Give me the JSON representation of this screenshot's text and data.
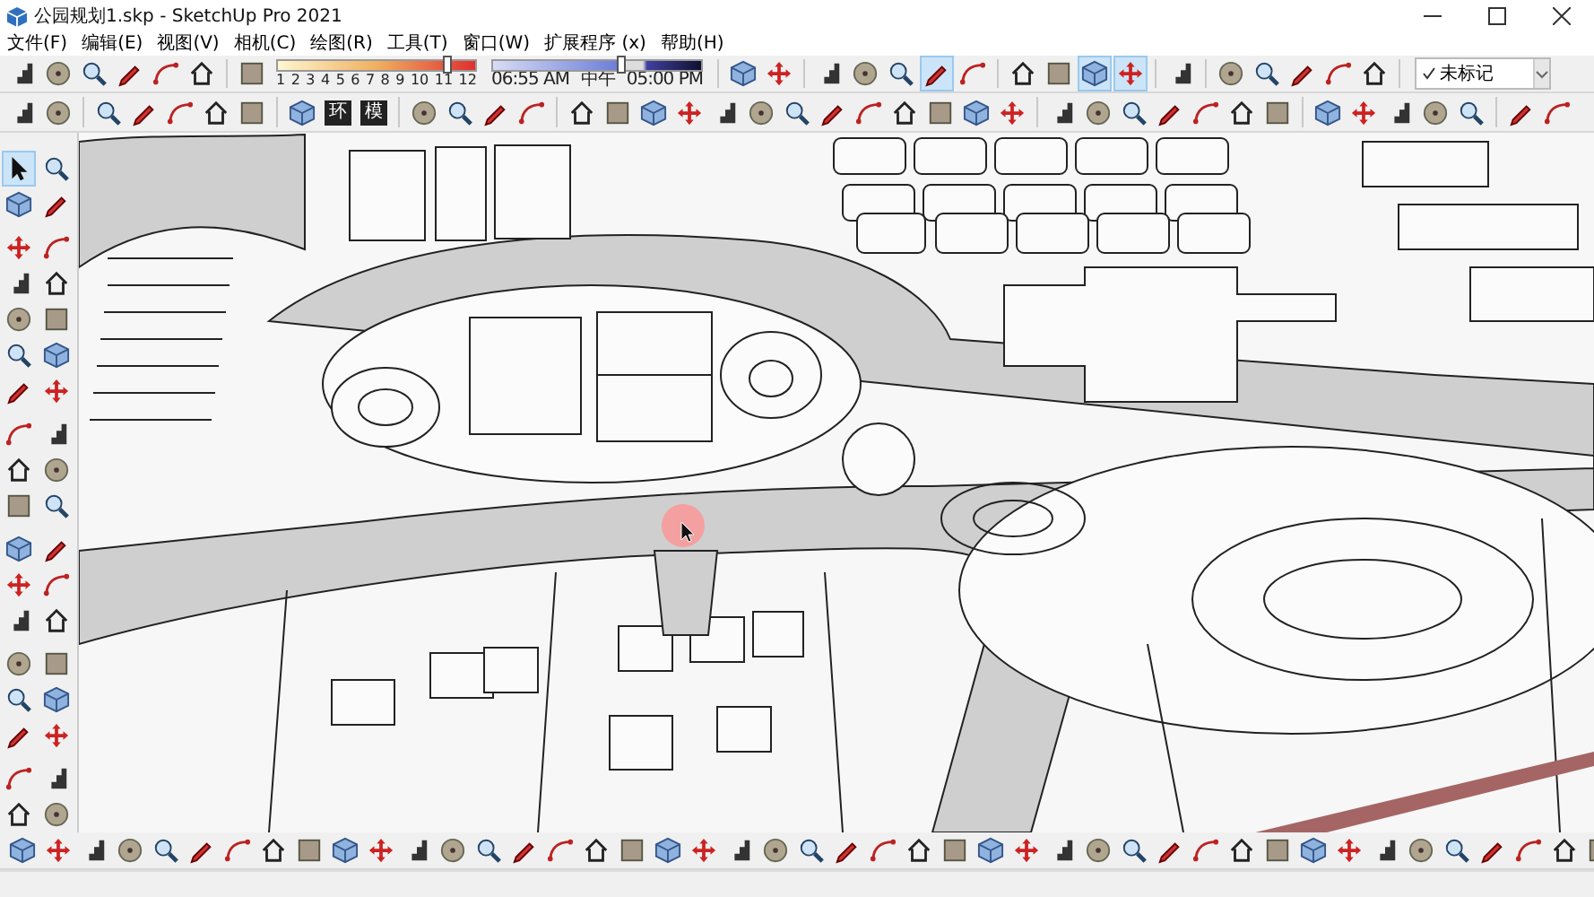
{
  "window": {
    "title": "公园规划1.skp - SketchUp Pro 2021"
  },
  "menu": [
    "文件(F)",
    "编辑(E)",
    "视图(V)",
    "相机(C)",
    "绘图(R)",
    "工具(T)",
    "窗口(W)",
    "扩展程序 (x)",
    "帮助(H)"
  ],
  "toolbar_row_1": [
    {
      "kind": "group",
      "buttons": [
        {
          "selected": false
        },
        {
          "selected": false
        },
        {
          "selected": false
        },
        {
          "selected": false
        },
        {
          "selected": false
        },
        {
          "selected": false
        }
      ]
    },
    {
      "kind": "group",
      "buttons": [
        {
          "selected": false
        }
      ]
    },
    {
      "kind": "month_slider",
      "labels": [
        "1",
        "2",
        "3",
        "4",
        "5",
        "6",
        "7",
        "8",
        "9",
        "10",
        "11",
        "12"
      ],
      "level": 0.86
    },
    {
      "kind": "time_slider",
      "labels": [
        "06:55 AM",
        "中午",
        "05:00 PM"
      ],
      "level": 0.62
    },
    {
      "kind": "group",
      "buttons": [
        {
          "selected": false
        },
        {
          "selected": false
        }
      ]
    },
    {
      "kind": "group",
      "buttons": [
        {
          "selected": false
        },
        {
          "selected": false
        },
        {
          "selected": false
        },
        {
          "selected": true
        },
        {
          "selected": false
        }
      ]
    },
    {
      "kind": "group",
      "buttons": [
        {
          "selected": false
        },
        {
          "selected": false
        },
        {
          "selected": true
        },
        {
          "selected": true
        }
      ]
    },
    {
      "kind": "group",
      "buttons": [
        {
          "selected": false
        }
      ]
    },
    {
      "kind": "group",
      "buttons": [
        {
          "selected": false
        },
        {
          "selected": false
        },
        {
          "selected": false
        },
        {
          "selected": false
        },
        {
          "selected": false
        }
      ]
    },
    {
      "kind": "dropdown",
      "value": "未标记",
      "checked": true
    }
  ],
  "toolbar_row_2": [
    {
      "buttons": [
        {
          "selected": false
        },
        {
          "selected": false
        }
      ]
    },
    {
      "buttons": [
        {
          "selected": false
        },
        {
          "selected": false
        },
        {
          "selected": false
        },
        {
          "selected": false
        },
        {
          "selected": false
        }
      ]
    },
    {
      "buttons": [
        {
          "selected": false
        },
        {
          "selected": false,
          "label": "环"
        },
        {
          "selected": false,
          "label": "模"
        }
      ]
    },
    {
      "buttons": [
        {
          "selected": false
        },
        {
          "selected": false
        },
        {
          "selected": false
        },
        {
          "selected": false
        }
      ]
    },
    {
      "buttons": [
        {
          "selected": false
        },
        {
          "selected": false
        },
        {
          "selected": false
        },
        {
          "selected": false
        },
        {
          "selected": false
        },
        {
          "selected": false
        },
        {
          "selected": false
        },
        {
          "selected": false
        },
        {
          "selected": false
        },
        {
          "selected": false
        },
        {
          "selected": false
        },
        {
          "selected": false
        },
        {
          "selected": false
        }
      ]
    },
    {
      "buttons": [
        {
          "selected": false
        },
        {
          "selected": false
        },
        {
          "selected": false
        },
        {
          "selected": false
        },
        {
          "selected": false
        },
        {
          "selected": false
        },
        {
          "selected": false
        }
      ]
    },
    {
      "buttons": [
        {
          "selected": false
        },
        {
          "selected": false
        },
        {
          "selected": false
        },
        {
          "selected": false
        },
        {
          "selected": false
        }
      ]
    },
    {
      "buttons": [
        {
          "selected": false
        },
        {
          "selected": false
        }
      ]
    }
  ],
  "left_toolbar": [
    {
      "buttons": [
        {
          "selected": true
        },
        {
          "selected": false
        },
        {
          "selected": false
        },
        {
          "selected": false
        }
      ]
    },
    {
      "buttons": [
        {
          "selected": false
        },
        {
          "selected": false
        },
        {
          "selected": false
        },
        {
          "selected": false
        },
        {
          "selected": false
        },
        {
          "selected": false
        },
        {
          "selected": false
        },
        {
          "selected": false
        },
        {
          "selected": false
        },
        {
          "selected": false
        }
      ]
    },
    {
      "buttons": [
        {
          "selected": false
        },
        {
          "selected": false
        },
        {
          "selected": false
        },
        {
          "selected": false
        },
        {
          "selected": false
        },
        {
          "selected": false
        }
      ]
    },
    {
      "buttons": [
        {
          "selected": false
        },
        {
          "selected": false
        },
        {
          "selected": false
        },
        {
          "selected": false
        },
        {
          "selected": false
        },
        {
          "selected": false
        }
      ]
    },
    {
      "buttons": [
        {
          "selected": false
        },
        {
          "selected": false
        },
        {
          "selected": false
        },
        {
          "selected": false
        },
        {
          "selected": false
        },
        {
          "selected": false
        }
      ]
    },
    {
      "buttons": [
        {
          "selected": false
        },
        {
          "selected": false
        },
        {
          "selected": false
        },
        {
          "selected": false
        }
      ]
    }
  ],
  "bottom_toolbar": [
    {
      "buttons": [
        {
          "selected": false
        },
        {
          "selected": false
        },
        {
          "selected": false
        },
        {
          "selected": false
        },
        {
          "selected": false
        },
        {
          "selected": false
        },
        {
          "selected": false
        },
        {
          "selected": false
        },
        {
          "selected": false
        },
        {
          "selected": false
        },
        {
          "selected": false
        },
        {
          "selected": false
        },
        {
          "selected": false
        },
        {
          "selected": false
        },
        {
          "selected": false
        },
        {
          "selected": false
        },
        {
          "selected": false
        },
        {
          "selected": false
        },
        {
          "selected": false
        },
        {
          "selected": false
        },
        {
          "selected": false
        },
        {
          "selected": false
        },
        {
          "selected": false
        },
        {
          "selected": false
        },
        {
          "selected": false
        },
        {
          "selected": false
        },
        {
          "selected": false
        },
        {
          "selected": false
        },
        {
          "selected": false
        },
        {
          "selected": false
        },
        {
          "selected": false
        },
        {
          "selected": false
        },
        {
          "selected": false
        },
        {
          "selected": false
        },
        {
          "selected": false
        },
        {
          "selected": false
        },
        {
          "selected": false
        },
        {
          "selected": false
        },
        {
          "selected": false
        },
        {
          "selected": false
        },
        {
          "selected": false
        },
        {
          "selected": false
        },
        {
          "selected": false
        },
        {
          "selected": false
        },
        {
          "selected": false
        }
      ]
    }
  ]
}
